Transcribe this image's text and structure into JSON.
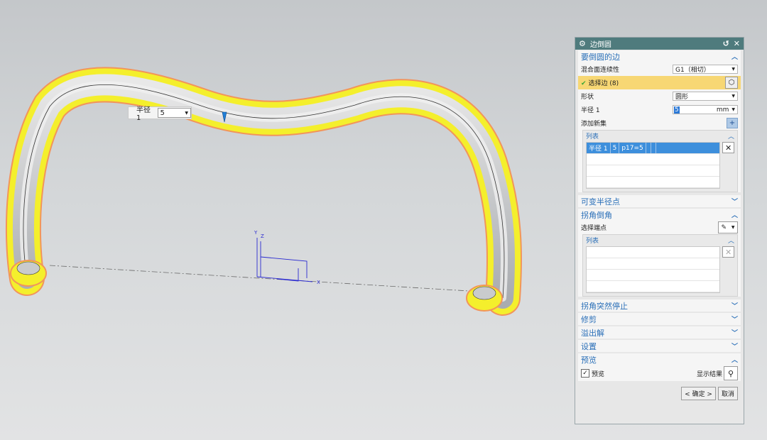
{
  "viewport": {
    "radius_popup": {
      "label": "半径 1",
      "value": "5"
    },
    "wcs_labels": {
      "y": "Y",
      "z": "Z",
      "x": "X"
    }
  },
  "dialog": {
    "title": "边倒圆",
    "section_edges": {
      "title": "要倒圆的边",
      "blend_continuity_label": "混合面连续性",
      "blend_continuity_value": "G1（相切）",
      "select_edge_label": "选择边 (8)",
      "shape_label": "形状",
      "shape_value": "圆形",
      "radius_label": "半径 1",
      "radius_value": "5",
      "radius_unit": "mm",
      "add_new_set_label": "添加新集",
      "list_title": "列表",
      "list_row": [
        "半径 1",
        "5",
        "p17=5"
      ]
    },
    "section_variable_radius": {
      "title": "可变半径点"
    },
    "section_corner_setback": {
      "title": "拐角倒角",
      "select_endpoint_label": "选择端点",
      "list_title": "列表"
    },
    "section_corner_stop": {
      "title": "拐角突然停止"
    },
    "section_trim": {
      "title": "修剪"
    },
    "section_overflow": {
      "title": "溢出解"
    },
    "section_settings": {
      "title": "设置"
    },
    "section_preview": {
      "title": "预览",
      "preview_checkbox_label": "预览",
      "preview_checked": true,
      "show_result_label": "显示结果"
    },
    "ok_label": "< 确定 >",
    "cancel_label": "取消"
  }
}
